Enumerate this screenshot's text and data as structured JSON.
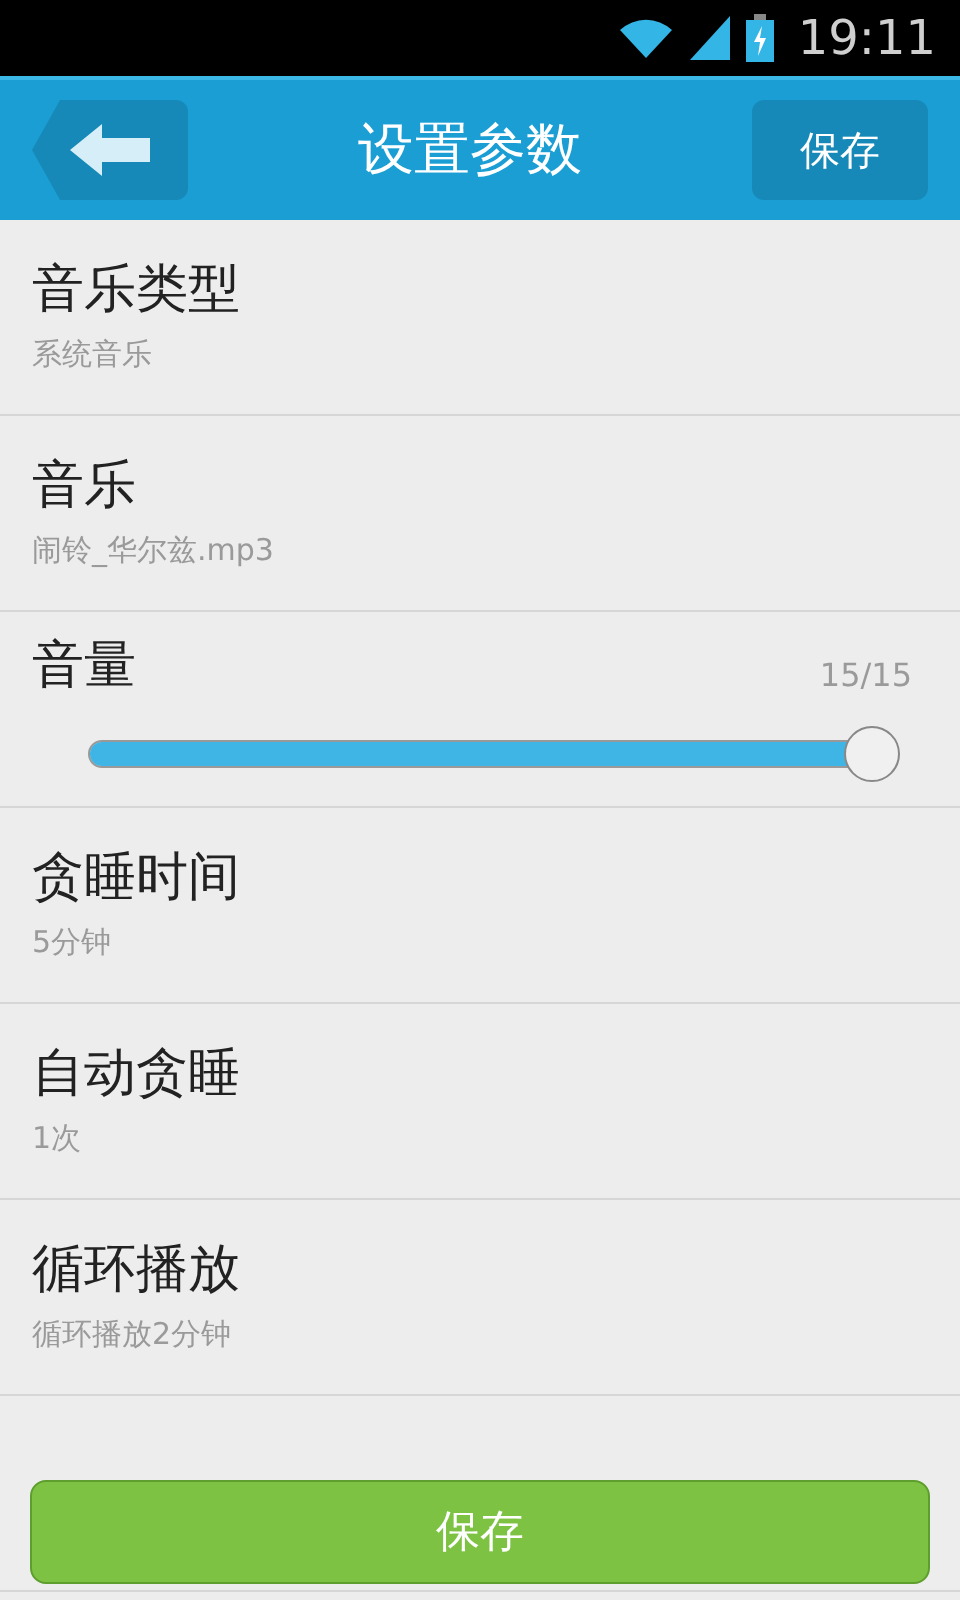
{
  "status_bar": {
    "time": "19:11"
  },
  "header": {
    "title": "设置参数",
    "save_button": "保存"
  },
  "settings": [
    {
      "kind": "text",
      "title": "音乐类型",
      "value": "系统音乐"
    },
    {
      "kind": "text",
      "title": "音乐",
      "value": "闹铃_华尔兹.mp3"
    },
    {
      "kind": "slider",
      "title": "音量",
      "reading": "15/15",
      "level": 1
    },
    {
      "kind": "text",
      "title": "贪睡时间",
      "value": "5分钟"
    },
    {
      "kind": "text",
      "title": "自动贪睡",
      "value": "1次"
    },
    {
      "kind": "text",
      "title": "循环播放",
      "value": "循环播放2分钟"
    }
  ],
  "bottom_button": "保存"
}
